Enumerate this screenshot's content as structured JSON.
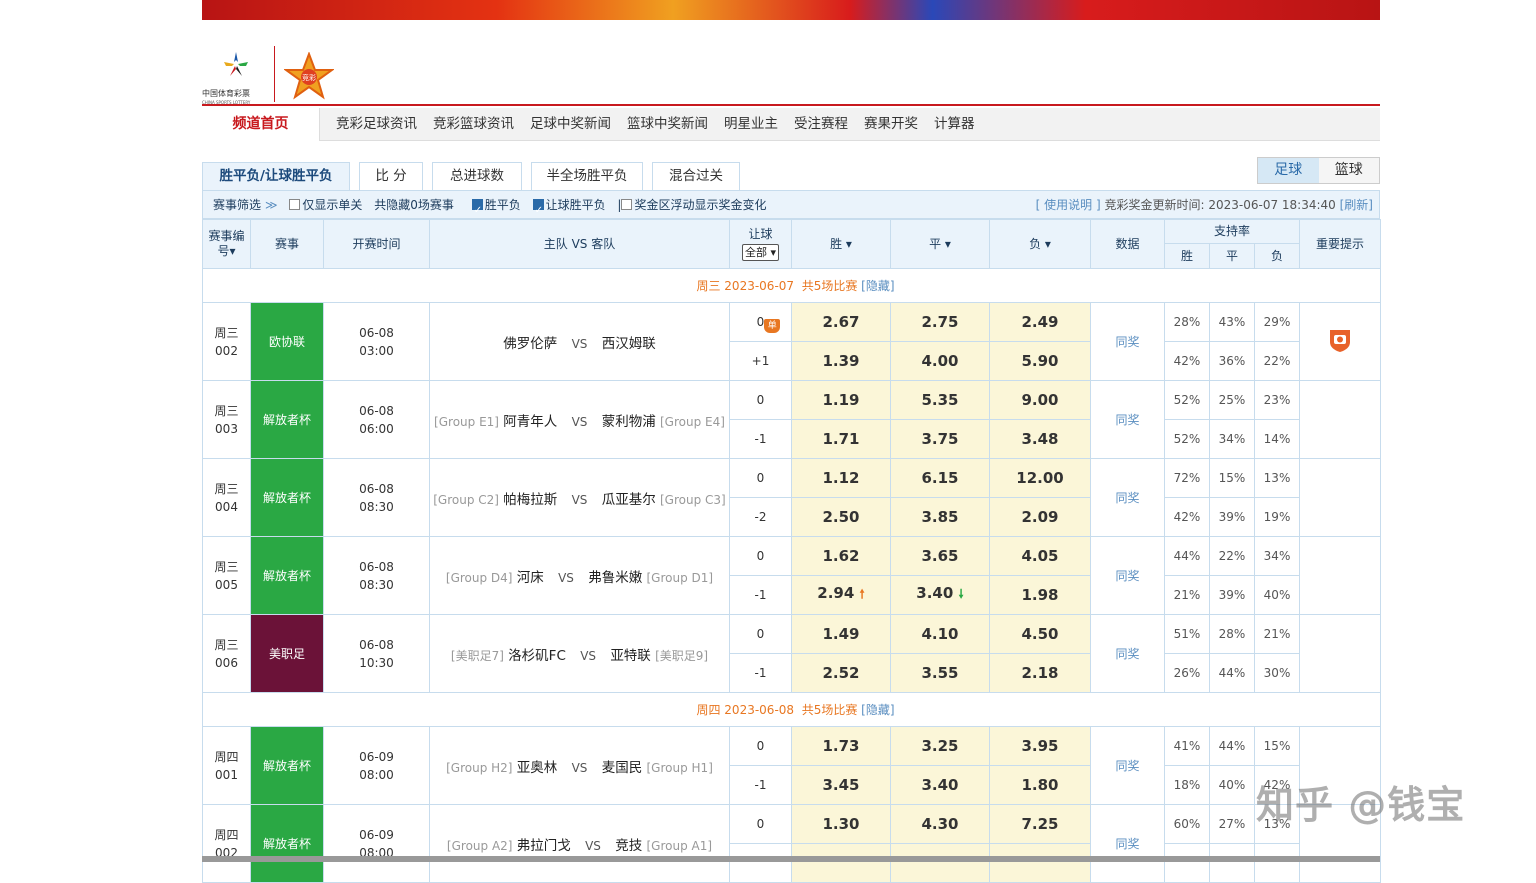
{
  "logo": {
    "cn": "中国体育彩票",
    "en": "CHINA SPORTS LOTTERY",
    "star_text": "竞彩"
  },
  "nav": {
    "home": "频道首页",
    "items": [
      "竞彩足球资讯",
      "竞彩篮球资讯",
      "足球中奖新闻",
      "篮球中奖新闻",
      "明星业主",
      "受注赛程",
      "赛果开奖",
      "计算器"
    ]
  },
  "tabs": [
    {
      "label": "胜平负/让球胜平负",
      "active": true
    },
    {
      "label": "比 分",
      "active": false
    },
    {
      "label": "总进球数",
      "active": false
    },
    {
      "label": "半全场胜平负",
      "active": false
    },
    {
      "label": "混合过关",
      "active": false
    }
  ],
  "sport_toggle": {
    "football": "足球",
    "basketball": "篮球"
  },
  "filter": {
    "screen": "赛事筛选",
    "screen_arrow": "≫",
    "single_only": "仅显示单关",
    "hidden_count": "共隐藏0场赛事",
    "wdl": "胜平负",
    "hwdl": "让球胜平负",
    "float": "奖金区浮动显示奖金变化",
    "help": "[ 使用说明 ]",
    "update_label": "竞彩奖金更新时间:",
    "update_time": "2023-06-07 18:34:40",
    "refresh": "[刷新]"
  },
  "headers": {
    "num": "赛事编号",
    "num_arrow": "▾",
    "league": "赛事",
    "time": "开赛时间",
    "teams": "主队 VS 客队",
    "handicap": "让球",
    "handicap_select": "全部",
    "win": "胜 ▾",
    "draw": "平 ▾",
    "lose": "负 ▾",
    "data": "数据",
    "support": "支持率",
    "s_win": "胜",
    "s_draw": "平",
    "s_lose": "负",
    "tip": "重要提示"
  },
  "groups": [
    {
      "day": "周三 2023-06-07",
      "count": "共5场比赛",
      "hide": "[隐藏]",
      "matches": [
        {
          "day": "周三",
          "no": "002",
          "league": "欧协联",
          "league_color": "#2aa844",
          "date": "06-08",
          "time": "03:00",
          "home_grp": "",
          "home": "佛罗伦萨",
          "vs": "VS",
          "away": "西汉姆联",
          "away_grp": "",
          "single": "单",
          "rows": [
            {
              "hc": "0",
              "w": "2.67",
              "d": "2.75",
              "l": "2.49",
              "w_ch": "",
              "d_ch": "",
              "sw": "28%",
              "sd": "43%",
              "sl": "29%"
            },
            {
              "hc": "+1",
              "w": "1.39",
              "d": "4.00",
              "l": "5.90",
              "w_ch": "",
              "d_ch": "",
              "sw": "42%",
              "sd": "36%",
              "sl": "22%"
            }
          ],
          "data": "同奖",
          "tip": true
        },
        {
          "day": "周三",
          "no": "003",
          "league": "解放者杯",
          "league_color": "#2aa844",
          "date": "06-08",
          "time": "06:00",
          "home_grp": "[Group E1]",
          "home": "阿青年人",
          "vs": "VS",
          "away": "蒙利物浦",
          "away_grp": "[Group E4]",
          "single": "",
          "rows": [
            {
              "hc": "0",
              "w": "1.19",
              "d": "5.35",
              "l": "9.00",
              "w_ch": "",
              "d_ch": "",
              "sw": "52%",
              "sd": "25%",
              "sl": "23%"
            },
            {
              "hc": "-1",
              "w": "1.71",
              "d": "3.75",
              "l": "3.48",
              "w_ch": "",
              "d_ch": "",
              "sw": "52%",
              "sd": "34%",
              "sl": "14%"
            }
          ],
          "data": "同奖",
          "tip": false
        },
        {
          "day": "周三",
          "no": "004",
          "league": "解放者杯",
          "league_color": "#2aa844",
          "date": "06-08",
          "time": "08:30",
          "home_grp": "[Group C2]",
          "home": "帕梅拉斯",
          "vs": "VS",
          "away": "瓜亚基尔",
          "away_grp": "[Group C3]",
          "single": "",
          "rows": [
            {
              "hc": "0",
              "w": "1.12",
              "d": "6.15",
              "l": "12.00",
              "w_ch": "",
              "d_ch": "",
              "sw": "72%",
              "sd": "15%",
              "sl": "13%"
            },
            {
              "hc": "-2",
              "w": "2.50",
              "d": "3.85",
              "l": "2.09",
              "w_ch": "",
              "d_ch": "",
              "sw": "42%",
              "sd": "39%",
              "sl": "19%"
            }
          ],
          "data": "同奖",
          "tip": false
        },
        {
          "day": "周三",
          "no": "005",
          "league": "解放者杯",
          "league_color": "#2aa844",
          "date": "06-08",
          "time": "08:30",
          "home_grp": "[Group D4]",
          "home": "河床",
          "vs": "VS",
          "away": "弗鲁米嫩",
          "away_grp": "[Group D1]",
          "single": "",
          "rows": [
            {
              "hc": "0",
              "w": "1.62",
              "d": "3.65",
              "l": "4.05",
              "w_ch": "",
              "d_ch": "",
              "sw": "44%",
              "sd": "22%",
              "sl": "34%"
            },
            {
              "hc": "-1",
              "w": "2.94",
              "d": "3.40",
              "l": "1.98",
              "w_ch": "up",
              "d_ch": "down",
              "sw": "21%",
              "sd": "39%",
              "sl": "40%"
            }
          ],
          "data": "同奖",
          "tip": false
        },
        {
          "day": "周三",
          "no": "006",
          "league": "美职足",
          "league_color": "#6b1238",
          "date": "06-08",
          "time": "10:30",
          "home_grp": "[美职足7]",
          "home": "洛杉矶FC",
          "vs": "VS",
          "away": "亚特联",
          "away_grp": "[美职足9]",
          "single": "",
          "rows": [
            {
              "hc": "0",
              "w": "1.49",
              "d": "4.10",
              "l": "4.50",
              "w_ch": "",
              "d_ch": "",
              "sw": "51%",
              "sd": "28%",
              "sl": "21%"
            },
            {
              "hc": "-1",
              "w": "2.52",
              "d": "3.55",
              "l": "2.18",
              "w_ch": "",
              "d_ch": "",
              "sw": "26%",
              "sd": "44%",
              "sl": "30%"
            }
          ],
          "data": "同奖",
          "tip": false
        }
      ]
    },
    {
      "day": "周四 2023-06-08",
      "count": "共5场比赛",
      "hide": "[隐藏]",
      "matches": [
        {
          "day": "周四",
          "no": "001",
          "league": "解放者杯",
          "league_color": "#2aa844",
          "date": "06-09",
          "time": "08:00",
          "home_grp": "[Group H2]",
          "home": "亚奥林",
          "vs": "VS",
          "away": "麦国民",
          "away_grp": "[Group H1]",
          "single": "",
          "rows": [
            {
              "hc": "0",
              "w": "1.73",
              "d": "3.25",
              "l": "3.95",
              "w_ch": "",
              "d_ch": "",
              "sw": "41%",
              "sd": "44%",
              "sl": "15%"
            },
            {
              "hc": "-1",
              "w": "3.45",
              "d": "3.40",
              "l": "1.80",
              "w_ch": "",
              "d_ch": "",
              "sw": "18%",
              "sd": "40%",
              "sl": "42%"
            }
          ],
          "data": "同奖",
          "tip": false
        },
        {
          "day": "周四",
          "no": "002",
          "league": "解放者杯",
          "league_color": "#2aa844",
          "date": "06-09",
          "time": "08:00",
          "home_grp": "[Group A2]",
          "home": "弗拉门戈",
          "vs": "VS",
          "away": "竞技",
          "away_grp": "[Group A1]",
          "single": "",
          "rows": [
            {
              "hc": "0",
              "w": "1.30",
              "d": "4.30",
              "l": "7.25",
              "w_ch": "",
              "d_ch": "",
              "sw": "60%",
              "sd": "27%",
              "sl": "13%"
            },
            {
              "hc": "",
              "w": "",
              "d": "",
              "l": "",
              "w_ch": "",
              "d_ch": "",
              "sw": "",
              "sd": "",
              "sl": ""
            }
          ],
          "data": "同奖",
          "tip": false
        }
      ]
    }
  ],
  "watermark": "知乎 @钱宝"
}
